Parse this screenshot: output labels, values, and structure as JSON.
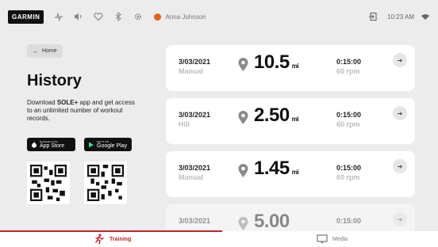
{
  "status_bar": {
    "brand": "GARMIN",
    "user_name": "Anna Johnson",
    "time": "10:23 AM"
  },
  "left_panel": {
    "home_label": "Home",
    "title": "History",
    "desc_prefix": "Download ",
    "desc_app": "SOLE+",
    "desc_suffix": " app and get access to an unlimited number of workout records.",
    "app_store_small": "Download on the",
    "app_store_big": "App Store",
    "google_play_small": "GET IT ON",
    "google_play_big": "Google Play"
  },
  "workouts": [
    {
      "date": "3/03/2021",
      "type": "Manual",
      "distance": "10.5",
      "unit": "mi",
      "duration": "0:15:00",
      "rpm": "60 rpm"
    },
    {
      "date": "3/03/2021",
      "type": "Hill",
      "distance": "2.50",
      "unit": "mi",
      "duration": "0:15:00",
      "rpm": "60 rpm"
    },
    {
      "date": "3/03/2021",
      "type": "Manual",
      "distance": "1.45",
      "unit": "mi",
      "duration": "0:15:00",
      "rpm": "60 rpm"
    },
    {
      "date": "3/03/2021",
      "type": "",
      "distance": "5.00",
      "unit": "",
      "duration": "0:15:00",
      "rpm": ""
    }
  ],
  "bottom_nav": {
    "training": "Training",
    "media": "Media"
  },
  "colors": {
    "accent": "#c7202c",
    "background": "#ececec",
    "card": "#ffffff"
  },
  "icons": [
    "bluetooth-icon",
    "volume-icon",
    "heart-rate-icon",
    "fan-icon",
    "settings-icon",
    "exit-icon",
    "wifi-icon",
    "location-pin-icon",
    "chevron-right-icon"
  ]
}
